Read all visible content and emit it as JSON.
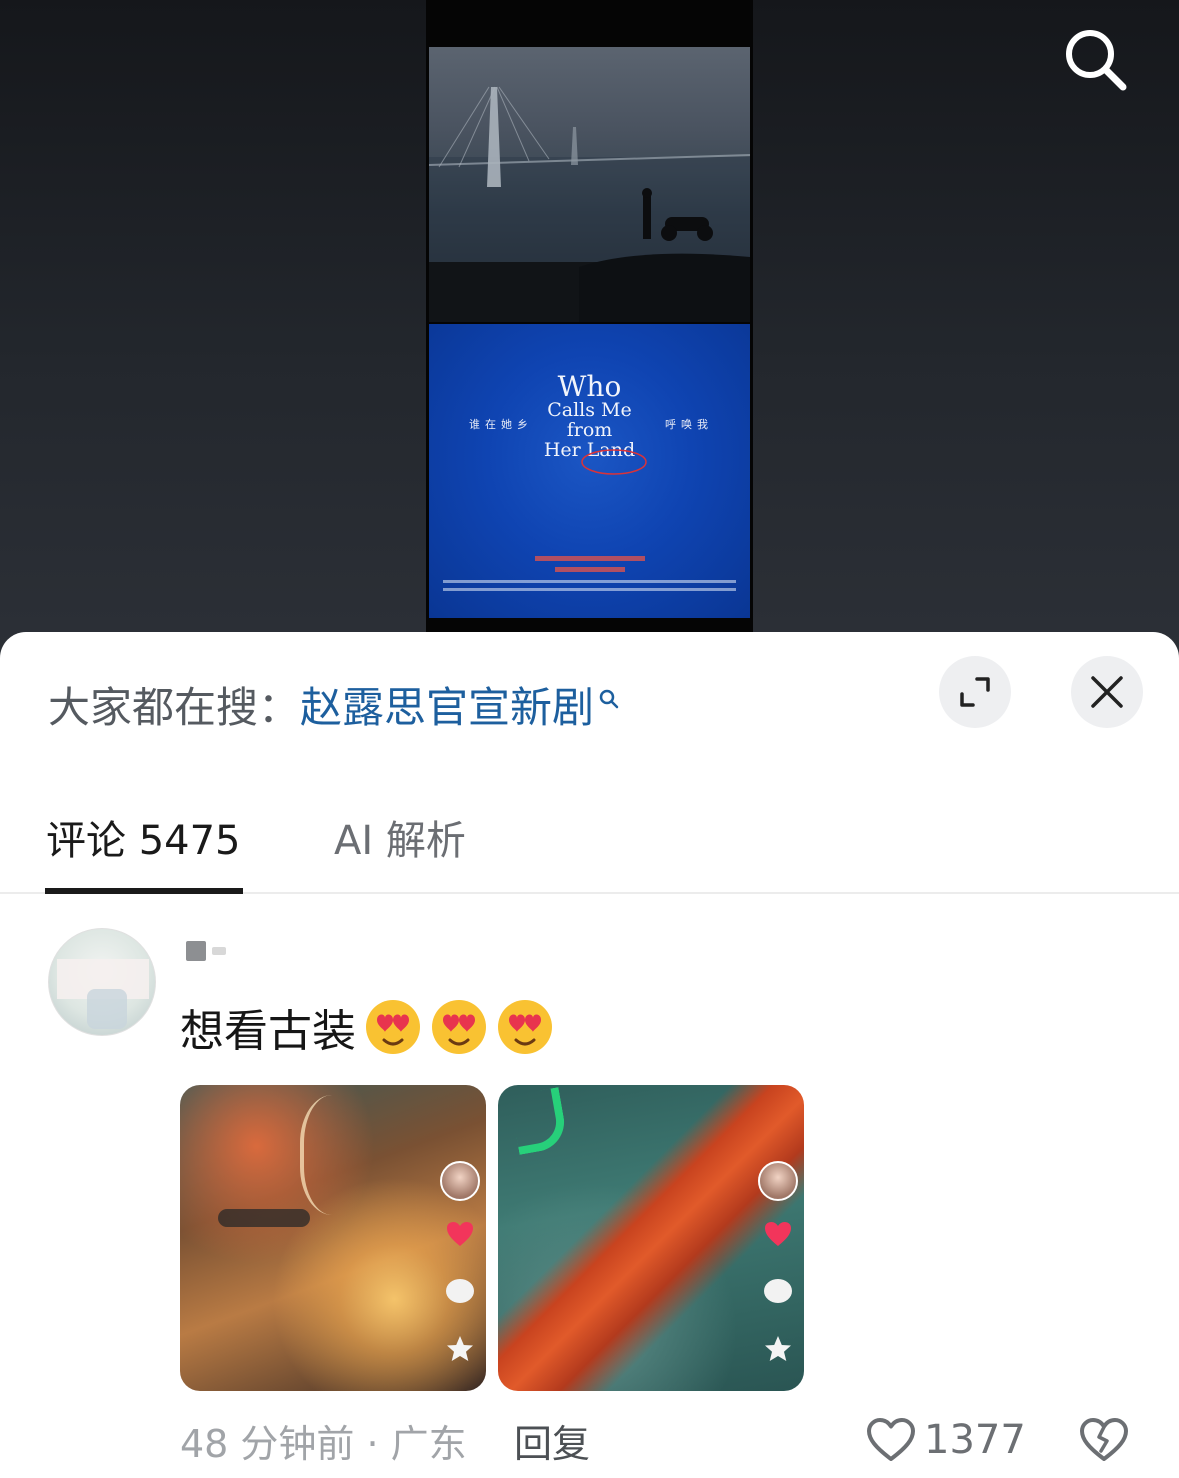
{
  "video": {
    "poster": {
      "title_line1": "Who",
      "title_line2": "Calls Me",
      "title_line3": "from",
      "title_line4": "Her Land",
      "left_text": "谁在她乡",
      "right_text": "呼唤我"
    }
  },
  "hot_search": {
    "label": "大家都在搜：",
    "term": "赵露思官宣新剧"
  },
  "tabs": [
    {
      "label": "评论 5475",
      "active": true
    },
    {
      "label": "AI 解析",
      "active": false
    }
  ],
  "comment": {
    "text": "想看古装",
    "emojis": [
      "smiling-face-with-heart-eyes",
      "smiling-face-with-heart-eyes",
      "smiling-face-with-heart-eyes"
    ],
    "meta": "48 分钟前 · 广东",
    "reply_label": "回复",
    "like_count": "1377"
  },
  "colors": {
    "hot_term": "#1d5f9e",
    "tab_active": "#1a1a1a",
    "meta_gray": "#a1a4a8"
  }
}
